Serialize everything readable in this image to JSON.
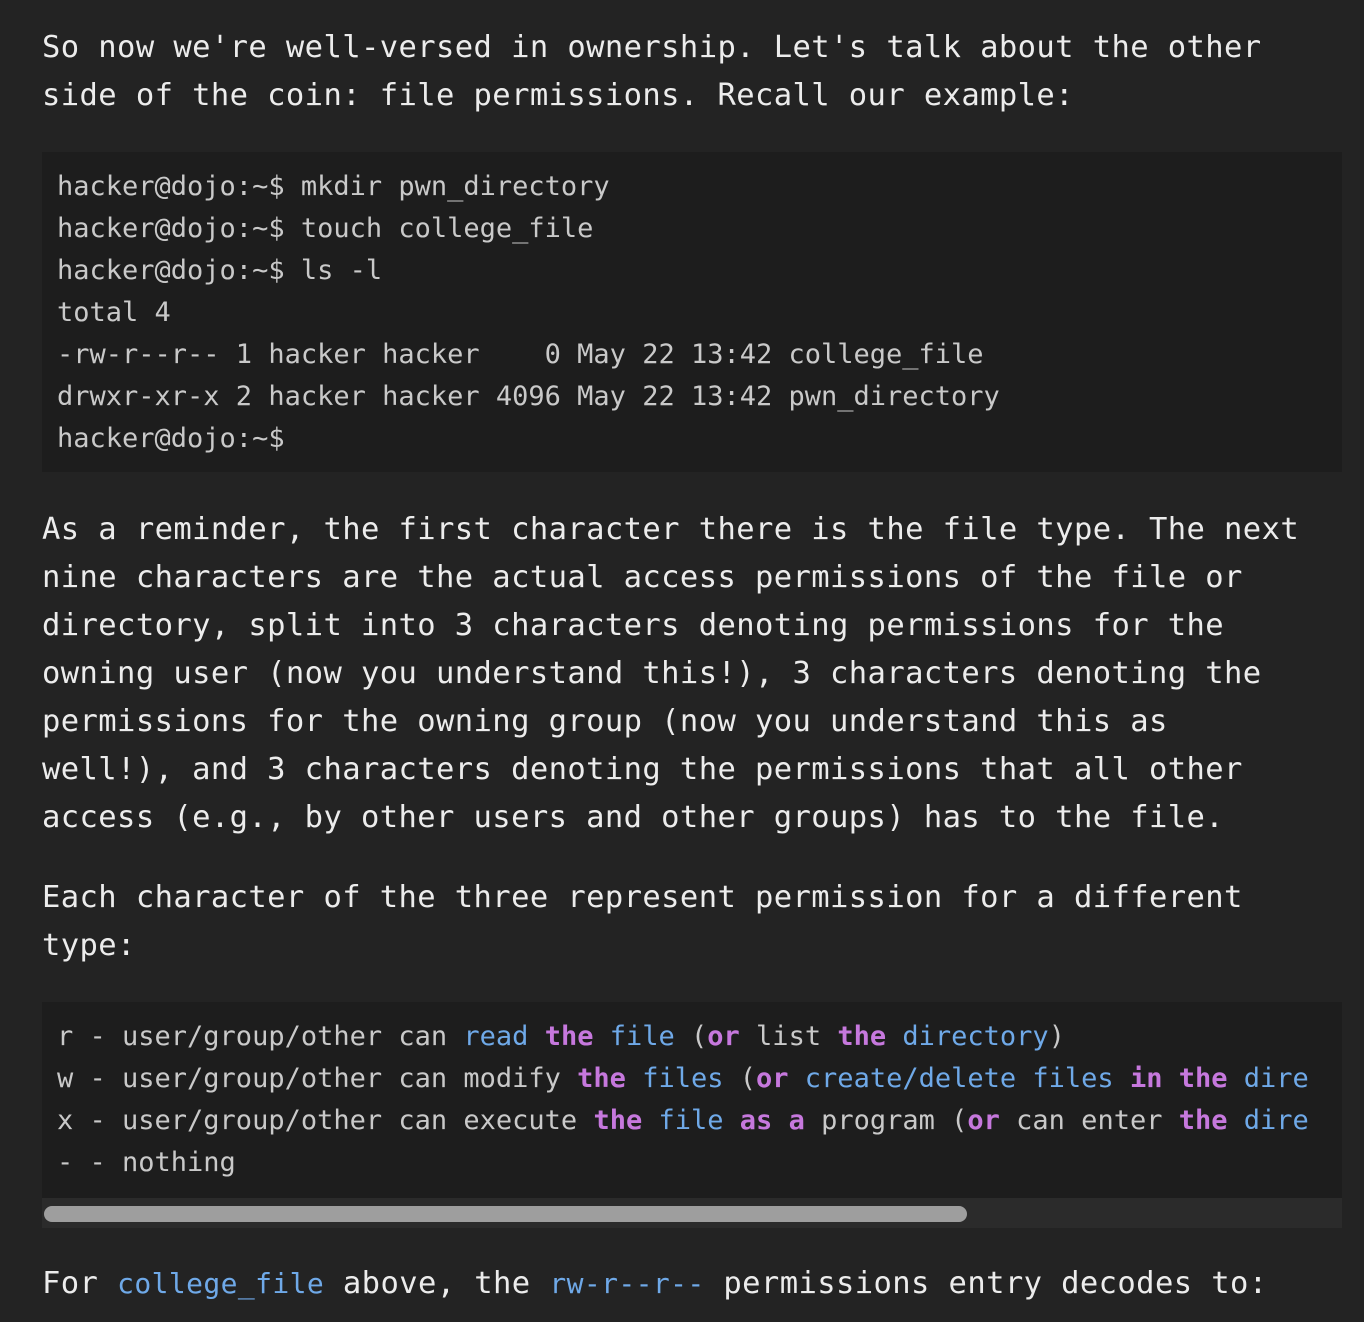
{
  "paragraph1": {
    "line1": "So now we're well-versed in ownership. Let's talk about the other",
    "line2": "side of the coin: file permissions. Recall our example:"
  },
  "terminal": {
    "lines": [
      "hacker@dojo:~$ mkdir pwn_directory",
      "hacker@dojo:~$ touch college_file",
      "hacker@dojo:~$ ls -l",
      "total 4",
      "-rw-r--r-- 1 hacker hacker    0 May 22 13:42 college_file",
      "drwxr-xr-x 2 hacker hacker 4096 May 22 13:42 pwn_directory",
      "hacker@dojo:~$"
    ]
  },
  "paragraph2": {
    "lines": [
      "As a reminder, the first character there is the file type. The next",
      "nine characters are the actual access permissions of the file or",
      "directory, split into 3 characters denoting permissions for the",
      "owning user (now you understand this!), 3 characters denoting the",
      "permissions for the owning group (now you understand this as",
      "well!), and 3 characters denoting the permissions that all other",
      "access (e.g., by other users and other groups) has to the file."
    ]
  },
  "paragraph3": {
    "line1": "Each character of the three represent permission for a different",
    "line2": "type:"
  },
  "permissions_block": {
    "r": {
      "p1": "r - user/group/other can ",
      "p2": "read",
      "p3": " ",
      "p4": "the",
      "p5": " ",
      "p6": "file",
      "p7": " (",
      "p8": "or",
      "p9": " list ",
      "p10": "the",
      "p11": " ",
      "p12": "directory",
      "p13": ")"
    },
    "w": {
      "p1": "w - user/group/other can modify ",
      "p2": "the",
      "p3": " ",
      "p4": "files",
      "p5": " (",
      "p6": "or",
      "p7": " ",
      "p8": "create/delete",
      "p9": " ",
      "p10": "files",
      "p11": " ",
      "p12": "in",
      "p13": " ",
      "p14": "the",
      "p15": " ",
      "p16": "dire"
    },
    "x": {
      "p1": "x - user/group/other can execute ",
      "p2": "the",
      "p3": " ",
      "p4": "file",
      "p5": " ",
      "p6": "as",
      "p7": " ",
      "p8": "a",
      "p9": " program (",
      "p10": "or",
      "p11": " can enter ",
      "p12": "the",
      "p13": " ",
      "p14": "dire"
    },
    "none": "- - nothing"
  },
  "paragraph4": {
    "t1": "For ",
    "code1": "college_file",
    "t2": " above, the ",
    "code2": "rw-r--r--",
    "t3": " permissions entry decodes to:"
  },
  "colors": {
    "background": "#232323",
    "code_background": "#1d1d1d",
    "keyword": "#c678dd",
    "identifier": "#6fa9e8"
  }
}
